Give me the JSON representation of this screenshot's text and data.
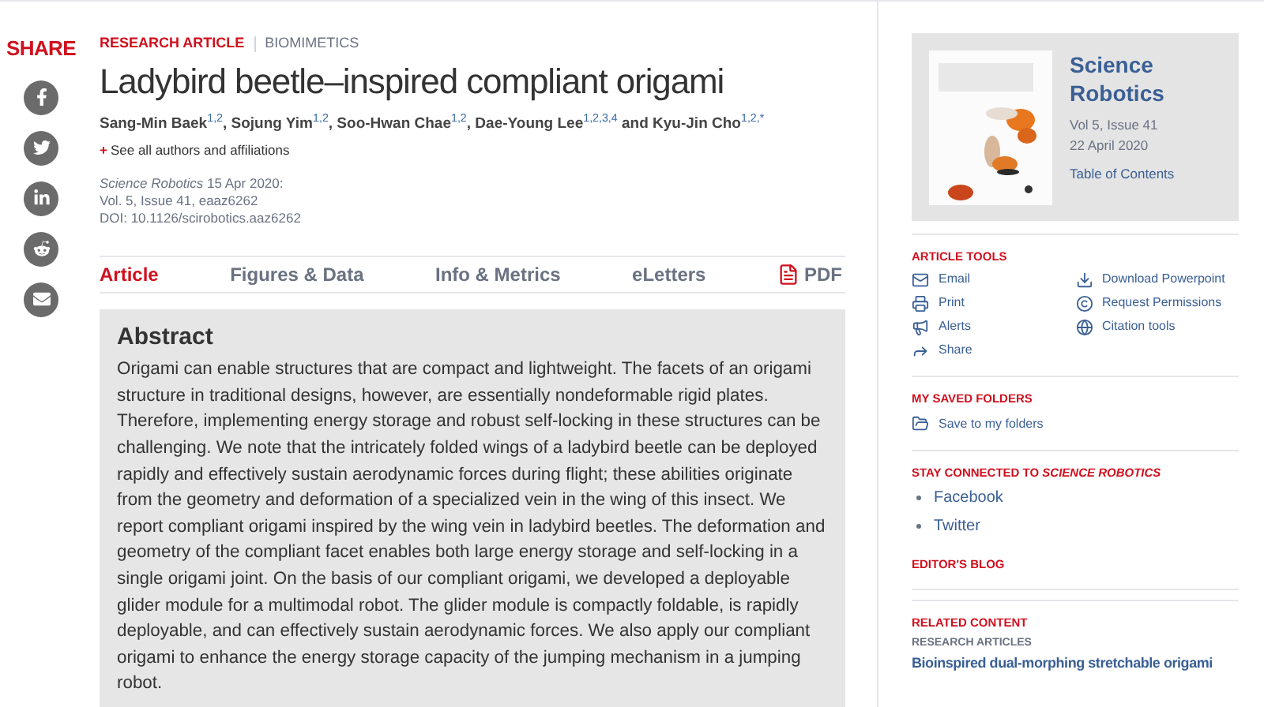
{
  "share": {
    "label": "SHARE"
  },
  "article": {
    "type": "RESEARCH ARTICLE",
    "category": "BIOMIMETICS",
    "title": "Ladybird beetle–inspired compliant origami",
    "authors": "Sang-Min Baek$^{1,2}$, Sojung Yim$^{1,2}$, Soo-Hwan Chae$^{1,2}$, Dae-Young Lee$^{1,2,3,4}$ and Kyu-Jin Cho$^{1,2,*}$",
    "affiliations_link": {
      "marker": "+",
      "label": "See all authors and affiliations"
    },
    "citation": [
      "*Science Robotics*  15 Apr 2020:",
      "Vol. 5, Issue 41, eaaz6262",
      "DOI: 10.1126/scirobotics.aaz6262"
    ]
  },
  "tabs": [
    {
      "label": "Article",
      "selected": true
    },
    {
      "label": "Figures & Data",
      "selected": false
    },
    {
      "label": "Info & Metrics",
      "selected": false
    },
    {
      "label": "eLetters",
      "selected": false
    },
    {
      "label": "PDF",
      "selected": false,
      "kind": "pdf"
    }
  ],
  "abstract": {
    "heading": "Abstract",
    "text": "Origami can enable structures that are compact and lightweight. The facets of an origami structure in traditional designs, however, are essentially nondeformable rigid plates. Therefore, implementing energy storage and robust self-locking in these structures can be challenging. We note that the intricately folded wings of a ladybird beetle can be deployed rapidly and effectively sustain aerodynamic forces during flight; these abilities originate from the geometry and deformation of a specialized vein in the wing of this insect. We report compliant origami inspired by the wing vein in ladybird beetles. The deformation and geometry of the compliant facet enables both large energy storage and self-locking in a single origami joint. On the basis of our compliant origami, we developed a deployable glider module for a multimodal robot. The glider module is compactly foldable, is rapidly deployable, and can effectively sustain aerodynamic forces. We also apply our compliant origami to enhance the energy storage capacity of the jumping mechanism in a jumping robot."
  },
  "journal": {
    "name": "Science Robotics",
    "issue": "Vol 5, Issue 41",
    "date": "22 April 2020",
    "toc_link": "Table of Contents"
  },
  "article_tools": {
    "heading": "ARTICLE TOOLS",
    "items": [
      {
        "label": "Email",
        "kind": "email"
      },
      {
        "label": "Download Powerpoint",
        "kind": "download"
      },
      {
        "label": "Print",
        "kind": "print"
      },
      {
        "label": "Request Permissions",
        "kind": "permissions"
      },
      {
        "label": "Alerts",
        "kind": "alerts"
      },
      {
        "label": "Citation tools",
        "kind": "citation"
      },
      {
        "label": "Share",
        "kind": "share"
      }
    ]
  },
  "saved_folders": {
    "heading": "MY SAVED FOLDERS",
    "link": "Save to my folders"
  },
  "stay_connected": {
    "heading": "STAY CONNECTED TO *SCIENCE ROBOTICS*",
    "links": [
      "Facebook",
      "Twitter"
    ]
  },
  "editors_blog": {
    "heading": "EDITOR'S BLOG"
  },
  "related": {
    "heading": "RELATED CONTENT",
    "subheading": "RESEARCH ARTICLES",
    "link": "Bioinspired dual-morphing stretchable origami"
  }
}
